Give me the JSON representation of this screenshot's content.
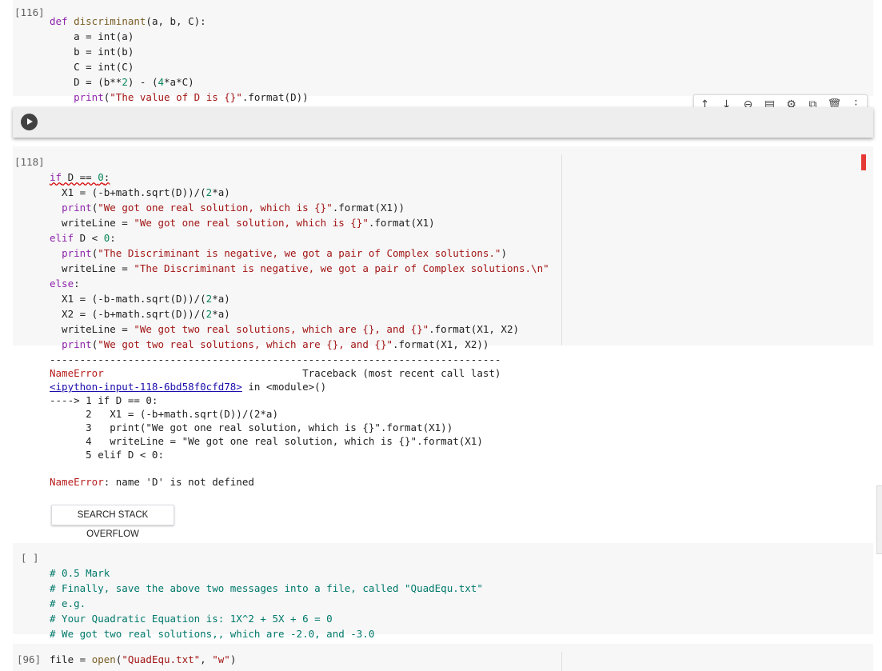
{
  "cell_116": {
    "prompt": "[116]",
    "lines": [
      "def discriminant(a, b, C):",
      "    a = int(a)",
      "    b = int(b)",
      "    C = int(C)",
      "    D = (b**2) - (4*a*C)",
      "    print(\"The value of D is {}\".format(D))"
    ]
  },
  "toolbar": {
    "icons": [
      "arrow-up",
      "arrow-down",
      "link",
      "comment",
      "settings",
      "mirror-cell",
      "delete",
      "more-vert"
    ],
    "glyphs": [
      "↑",
      "↓",
      "⊖",
      "▤",
      "⚙",
      "⧉",
      "🗑",
      "⋮"
    ]
  },
  "cell_118": {
    "prompt": "[118]",
    "lines": [
      "if D == 0:",
      "  X1 = (-b+math.sqrt(D))/(2*a)",
      "  print(\"We got one real solution, which is {}\".format(X1))",
      "  writeLine = \"We got one real solution, which is {}\".format(X1)",
      "elif D < 0:",
      "  print(\"The Discriminant is negative, we got a pair of Complex solutions.\")",
      "  writeLine = \"The Discriminant is negative, we got a pair of Complex solutions.\\n\"",
      "else:",
      "  X1 = (-b-math.sqrt(D))/(2*a)",
      "  X2 = (-b+math.sqrt(D))/(2*a)",
      "  writeLine = \"We got two real solutions, which are {}, and {}\".format(X1, X2)",
      "  print(\"We got two real solutions, which are {}, and {}\".format(X1, X2))"
    ]
  },
  "traceback": {
    "separator": "---------------------------------------------------------------------------",
    "error_name": "NameError",
    "header_right": "Traceback (most recent call last)",
    "link": "<ipython-input-118-6bd58f0cfd78>",
    "link_suffix": " in <module>()",
    "arrow": "----> 1 if D == 0:",
    "lines": [
      "      2   X1 = (-b+math.sqrt(D))/(2*a)",
      "      3   print(\"We got one real solution, which is {}\".format(X1))",
      "      4   writeLine = \"We got one real solution, which is {}\".format(X1)",
      "      5 elif D < 0:"
    ],
    "message_name": "NameError",
    "message": ": name 'D' is not defined",
    "so_button": "SEARCH STACK OVERFLOW"
  },
  "cell_comment": {
    "prompt": "[ ]",
    "lines": [
      "# 0.5 Mark",
      "# Finally, save the above two messages into a file, called \"QuadEqu.txt\"",
      "# e.g.",
      "# Your Quadratic Equation is: 1X^2 + 5X + 6 = 0",
      "# We got two real solutions,, which are -2.0, and -3.0"
    ]
  },
  "cell_96": {
    "prompt": "[96]",
    "line": "file = open(\"QuadEqu.txt\", \"w\")"
  }
}
